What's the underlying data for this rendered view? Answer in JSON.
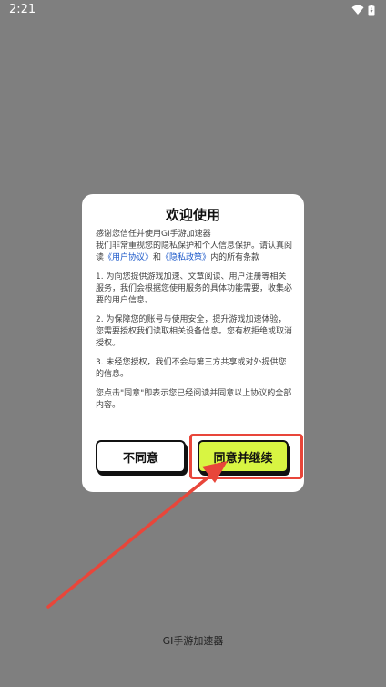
{
  "status_bar": {
    "time": "2:21"
  },
  "dialog": {
    "title": "欢迎使用",
    "intro_line1": "感谢您信任并使用GI手游加速器",
    "intro_line2_a": "我们非常重视您的隐私保护和个人信息保护。请认真阅读",
    "user_agreement_link": "《用户协议》",
    "and_text": "和",
    "privacy_policy_link": "《隐私政策》",
    "intro_line2_b": "内的所有条款",
    "clause1": "1. 为向您提供游戏加速、文章阅读、用户注册等相关服务，我们会根据您使用服务的具体功能需要，收集必要的用户信息。",
    "clause2": "2. 为保障您的账号与使用安全，提升游戏加速体验，您需要授权我们读取相关设备信息。您有权拒绝或取消授权。",
    "clause3": "3. 未经您授权，我们不会与第三方共享或对外提供您的信息。",
    "closing": "您点击\"同意\"即表示您已经阅读并同意以上协议的全部内容。",
    "disagree_label": "不同意",
    "agree_label": "同意并继续"
  },
  "app_name": "GI手游加速器",
  "colors": {
    "overlay": "#7f7f7f",
    "agree_button": "#d8f542",
    "highlight": "#e8463a",
    "link": "#1a57c9"
  }
}
